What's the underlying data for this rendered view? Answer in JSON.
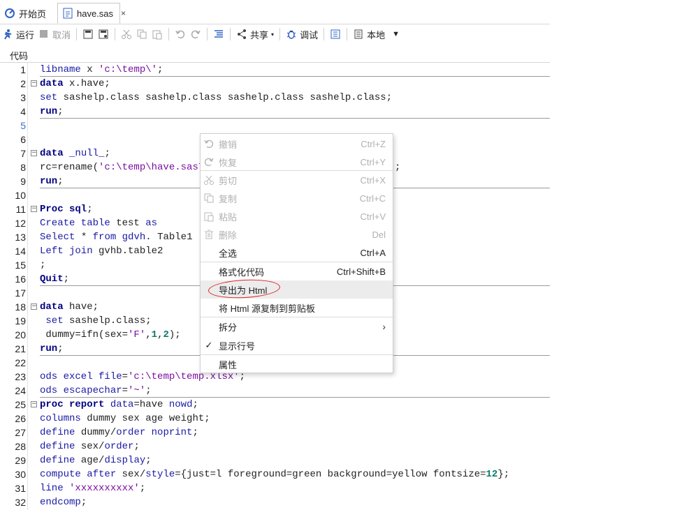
{
  "tabs": [
    {
      "label": "开始页",
      "icon": "start-page-icon"
    },
    {
      "label": "have.sas",
      "icon": "sas-file-icon",
      "close": "×"
    }
  ],
  "toolbar": {
    "run": "运行",
    "cancel": "取消",
    "share": "共享",
    "debug": "调试",
    "local": "本地"
  },
  "code_tab_label": "代码",
  "code_lines": [
    {
      "n": "1",
      "html": "<span class='kw'>libname</span> x <span class='str'>'c:\\temp\\'</span>;"
    },
    {
      "n": "2",
      "html": "<span class='kwb'>data</span> x.have;",
      "fold": true
    },
    {
      "n": "3",
      "html": "<span class='kw'>set</span> sashelp.class sashelp.class sashelp.class sashelp.class;"
    },
    {
      "n": "4",
      "html": "<span class='kwb'>run</span>;"
    },
    {
      "n": "5",
      "html": "",
      "blue": true
    },
    {
      "n": "6",
      "html": ""
    },
    {
      "n": "7",
      "html": "<span class='kwb'>data</span> <span class='kw'>_null_</span>;",
      "fold": true
    },
    {
      "n": "8",
      "html": "rc=rename(<span class='str'>'c:\\temp\\have.sas7bd</span>",
      "tail": ";"
    },
    {
      "n": "9",
      "html": "<span class='kwb'>run</span>;"
    },
    {
      "n": "10",
      "html": ""
    },
    {
      "n": "11",
      "html": "<span class='kwb'>Proc sql</span>;",
      "fold": true
    },
    {
      "n": "12",
      "html": "<span class='kw'>Create table</span> test <span class='kw'>as</span>"
    },
    {
      "n": "13",
      "html": "<span class='kw'>Select</span> * <span class='kw'>from</span> <span class='kw'>gdvh</span>. Table1"
    },
    {
      "n": "14",
      "html": "<span class='kw'>Left join</span> gvhb.table2"
    },
    {
      "n": "15",
      "html": ";"
    },
    {
      "n": "16",
      "html": "<span class='kwb'>Quit</span>;"
    },
    {
      "n": "17",
      "html": ""
    },
    {
      "n": "18",
      "html": "<span class='kwb'>data</span> have;",
      "fold": true
    },
    {
      "n": "19",
      "html": " <span class='kw'>set</span> sashelp.class;"
    },
    {
      "n": "20",
      "html": " dummy=ifn(sex=<span class='str'>'F'</span>,<span class='num'>1</span>,<span class='num'>2</span>);"
    },
    {
      "n": "21",
      "html": "<span class='kwb'>run</span>;"
    },
    {
      "n": "22",
      "html": ""
    },
    {
      "n": "23",
      "html": "<span class='kw'>ods excel file</span>=<span class='str'>'c:\\temp\\temp.xlsx'</span>;"
    },
    {
      "n": "24",
      "html": "<span class='kw'>ods escapechar</span>=<span class='str'>'~'</span>;"
    },
    {
      "n": "25",
      "html": "<span class='kwb'>proc report</span> <span class='kw'>data</span>=have <span class='kw'>nowd</span>;",
      "fold": true
    },
    {
      "n": "26",
      "html": "<span class='kw'>columns</span> dummy sex age weight;"
    },
    {
      "n": "27",
      "html": "<span class='kw'>define</span> dummy/<span class='kw'>order noprint</span>;"
    },
    {
      "n": "28",
      "html": "<span class='kw'>define</span> sex/<span class='kw'>order</span>;"
    },
    {
      "n": "29",
      "html": "<span class='kw'>define</span> age/<span class='kw'>display</span>;"
    },
    {
      "n": "30",
      "html": "<span class='kw'>compute after</span> sex/<span class='kw'>style</span>={just=l foreground=green background=yellow fontsize=<span class='num'>12</span>};"
    },
    {
      "n": "31",
      "html": "<span class='kw'>line</span> <span class='str'>'xxxxxxxxxx'</span>;"
    },
    {
      "n": "32",
      "html": "<span class='kw'>endcomp</span>;"
    }
  ],
  "context_menu": [
    {
      "label": "撤销",
      "shortcut": "Ctrl+Z",
      "disabled": true,
      "icon": "undo-icon"
    },
    {
      "label": "恢复",
      "shortcut": "Ctrl+Y",
      "disabled": true,
      "icon": "redo-icon"
    },
    {
      "label": "剪切",
      "shortcut": "Ctrl+X",
      "disabled": true,
      "icon": "cut-icon"
    },
    {
      "label": "复制",
      "shortcut": "Ctrl+C",
      "disabled": true,
      "icon": "copy-icon"
    },
    {
      "label": "粘贴",
      "shortcut": "Ctrl+V",
      "disabled": true,
      "icon": "paste-icon"
    },
    {
      "label": "删除",
      "shortcut": "Del",
      "disabled": true,
      "icon": "delete-icon"
    },
    {
      "label": "全选",
      "shortcut": "Ctrl+A"
    },
    {
      "label": "格式化代码",
      "shortcut": "Ctrl+Shift+B"
    },
    {
      "label": "导出为 Html",
      "shortcut": "",
      "highlighted": true
    },
    {
      "label": "将 Html 源复制到剪贴板",
      "shortcut": ""
    },
    {
      "label": "拆分",
      "shortcut": "",
      "submenu": "›"
    },
    {
      "label": "显示行号",
      "shortcut": "",
      "checked": "✓"
    },
    {
      "label": "属性",
      "shortcut": ""
    }
  ],
  "colors": {
    "keyword": "#1a1aa6",
    "string": "#7a0fa0",
    "number": "#0a7a6f",
    "annotation": "#e02020"
  }
}
